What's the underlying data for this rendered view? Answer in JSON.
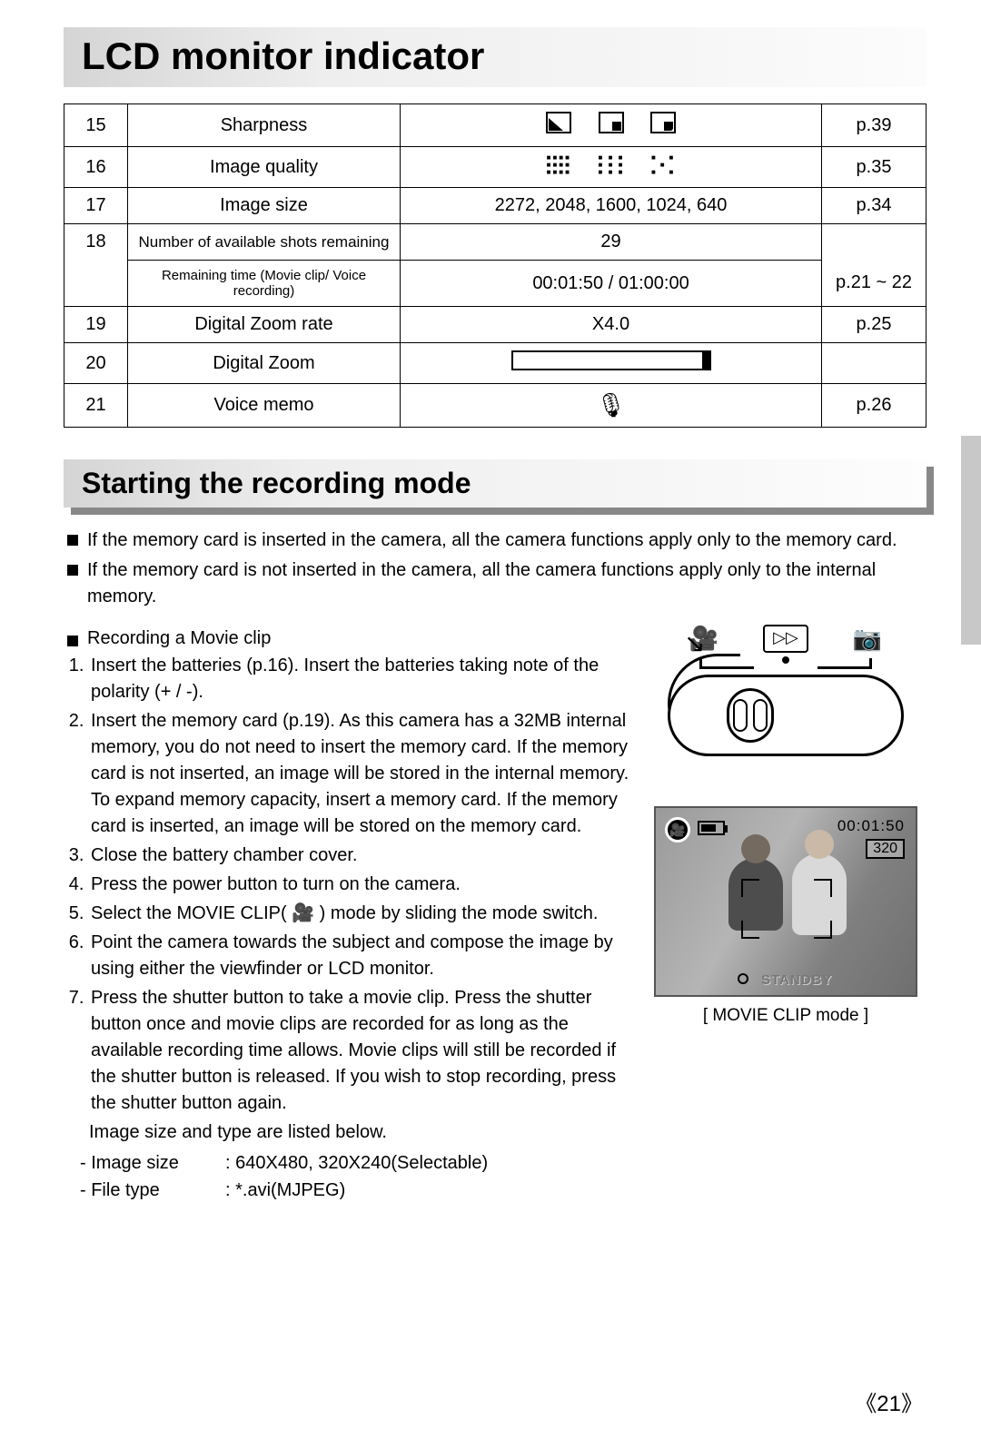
{
  "title": "LCD monitor indicator",
  "table": {
    "rows": [
      {
        "num": "15",
        "desc": "Sharpness",
        "val_type": "sharpness",
        "page": "p.39"
      },
      {
        "num": "16",
        "desc": "Image quality",
        "val_type": "quality",
        "page": "p.35"
      },
      {
        "num": "17",
        "desc": "Image size",
        "val": "2272, 2048, 1600, 1024, 640",
        "page": "p.34"
      },
      {
        "num": "18",
        "desc": "Number of available shots remaining",
        "val": "29",
        "page": "",
        "desc_cls": "desc-small"
      },
      {
        "num": "",
        "desc": "Remaining time (Movie clip/ Voice recording)",
        "val": "00:01:50 / 01:00:00",
        "page": "p.21 ~ 22",
        "desc_cls": "desc-xs"
      },
      {
        "num": "19",
        "desc": "Digital Zoom rate",
        "val": "X4.0",
        "page": "p.25"
      },
      {
        "num": "20",
        "desc": "Digital Zoom",
        "val_type": "zoombar",
        "page": ""
      },
      {
        "num": "21",
        "desc": "Voice memo",
        "val_type": "mic",
        "page": "p.26"
      }
    ]
  },
  "section2": {
    "heading": "Starting the recording mode",
    "bullets": [
      "If the memory card is inserted in the camera, all the camera functions apply only to the memory card.",
      "If the memory card is not inserted in the camera, all the camera functions apply only to the internal memory."
    ],
    "sub_heading": "Recording a Movie clip",
    "steps": [
      "Insert the batteries (p.16). Insert the batteries taking note of the polarity (+ / -).",
      "Insert the memory card (p.19). As this camera has a 32MB internal memory, you do not need to insert the memory card. If the memory card is not inserted, an image will be stored in the internal memory. To expand memory capacity, insert a memory card. If the memory card is inserted, an image will be stored on the memory card.",
      "Close the battery chamber cover.",
      "Press the power button to turn on the camera.",
      "Select the MOVIE CLIP( 🎥 ) mode by sliding the mode switch.",
      "Point the camera towards the subject and compose the image by using either the viewfinder or LCD monitor.",
      "Press the shutter button to take a movie clip. Press the shutter button once and movie clips are recorded for as long as the available recording time allows. Movie clips will still be recorded if the shutter button is released. If you wish to stop recording, press the shutter button again."
    ],
    "tail": "Image size and type are listed below.",
    "specs": [
      {
        "label": "- Image size",
        "value": ": 640X480, 320X240(Selectable)"
      },
      {
        "label": "- File type",
        "value": ": *.avi(MJPEG)"
      }
    ]
  },
  "lcd": {
    "time": "00:01:50",
    "resolution": "320",
    "status": "STANDBY",
    "caption": "[ MOVIE CLIP mode ]"
  },
  "page_number": "21"
}
